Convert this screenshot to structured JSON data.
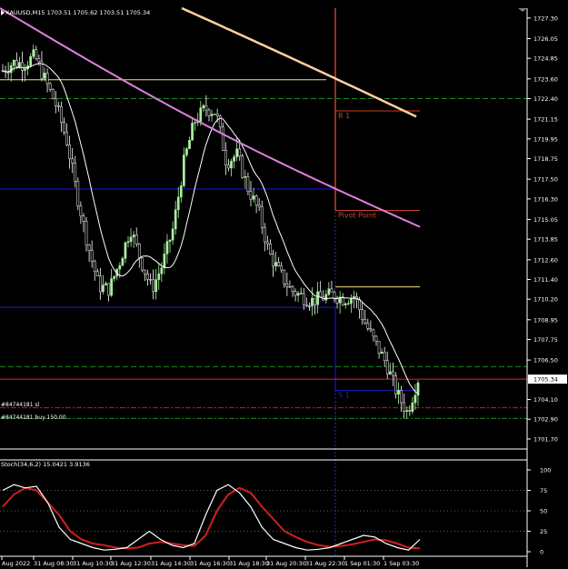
{
  "header": {
    "symbol": "XAUUSD,M15",
    "ohlc": "1703.51 1705.62 1703.51 1705.34"
  },
  "price_axis": {
    "ticks": [
      "1727.30",
      "1726.05",
      "1724.85",
      "1723.60",
      "1722.40",
      "1721.15",
      "1719.95",
      "1718.75",
      "1717.50",
      "1716.30",
      "1715.05",
      "1713.85",
      "1712.60",
      "1711.40",
      "1710.20",
      "1708.95",
      "1707.75",
      "1706.50",
      "1704.10",
      "1702.90",
      "1701.70"
    ],
    "current_price": "1705.34"
  },
  "pivot_labels": {
    "r1": "R 1",
    "pivot": "Pivot Point",
    "s1": "S 1"
  },
  "orders": {
    "sl": "#84744181 sl",
    "buy": "#84744181 buy 150.00"
  },
  "stoch": {
    "label": "Stoch(34,6,2) 15.0421 3.9136",
    "levels": [
      "100",
      "75",
      "50",
      "25",
      "0"
    ]
  },
  "time_axis": {
    "labels": [
      "Aug 2022",
      "31 Aug 08:30",
      "31 Aug 10:30",
      "31 Aug 12:30",
      "31 Aug 14:30",
      "31 Aug 16:30",
      "31 Aug 18:30",
      "31 Aug 20:30",
      "31 Aug 22:30",
      "1 Sep 01:30",
      "1 Sep 03:30"
    ]
  },
  "colors": {
    "bull": "#aaf0a0",
    "bear": "#ffffff",
    "ma_white": "#ffffff",
    "ma_violet": "#e080e0",
    "ma_peach": "#ffd0a0",
    "pivot_red": "#c8402a",
    "yellow_line": "#f0e080",
    "blue_line": "#1010a0",
    "green_dash": "#1d8a1d",
    "stoch_red": "#d02020"
  },
  "chart_data": {
    "type": "line",
    "title": "XAUUSD,M15",
    "ylim": [
      1701.2,
      1727.9
    ],
    "price_series": [
      1724.1,
      1724.6,
      1724.5,
      1725.0,
      1723.5,
      1722.0,
      1719.9,
      1716.5,
      1713.5,
      1711.0,
      1710.8,
      1712.5,
      1714.5,
      1712.5,
      1710.8,
      1712.3,
      1714.5,
      1718.5,
      1721.0,
      1721.8,
      1721.6,
      1718.5,
      1719.0,
      1717.0,
      1715.6,
      1713.0,
      1711.8,
      1710.8,
      1710.4,
      1710.1,
      1710.3,
      1710.5,
      1710.2,
      1710.4,
      1708.8,
      1707.5,
      1706.3,
      1704.5,
      1703.3,
      1705.34
    ],
    "stoch_main": [
      75,
      82,
      78,
      80,
      60,
      30,
      15,
      10,
      5,
      2,
      3,
      5,
      15,
      25,
      15,
      8,
      5,
      10,
      45,
      75,
      82,
      72,
      55,
      30,
      15,
      10,
      5,
      2,
      3,
      5,
      10,
      15,
      20,
      18,
      10,
      5,
      2,
      15
    ],
    "stoch_signal": [
      55,
      70,
      78,
      75,
      60,
      45,
      25,
      15,
      10,
      8,
      5,
      4,
      5,
      10,
      12,
      10,
      8,
      7,
      20,
      50,
      70,
      78,
      72,
      55,
      40,
      25,
      18,
      12,
      8,
      6,
      7,
      9,
      12,
      15,
      14,
      10,
      5,
      4
    ]
  }
}
